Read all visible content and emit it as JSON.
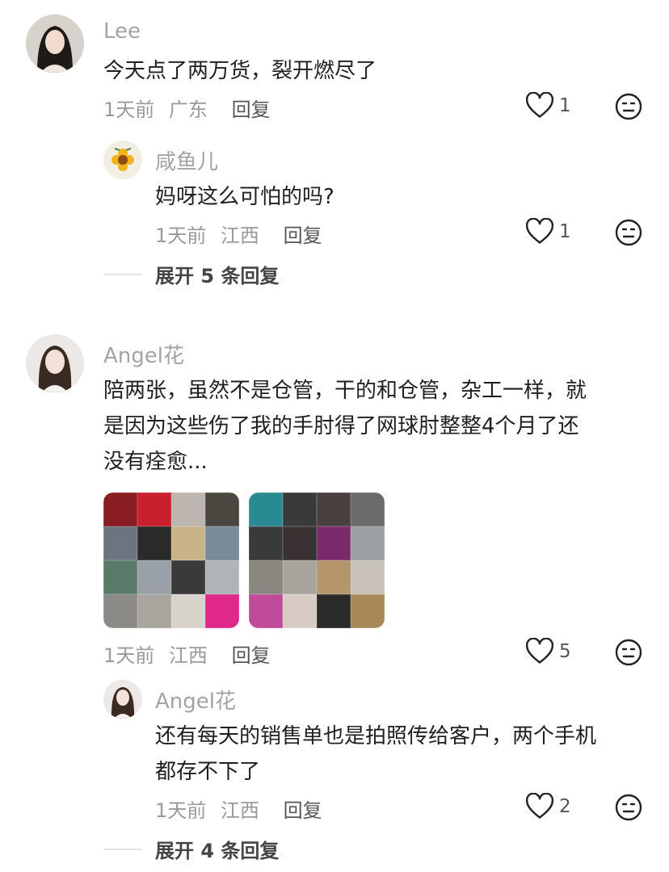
{
  "comments": [
    {
      "username": "Lee",
      "text": "今天点了两万货，裂开燃尽了",
      "time": "1天前",
      "location": "广东",
      "reply_label": "回复",
      "likes": "1",
      "replies": [
        {
          "username": "咸鱼儿",
          "text": "妈呀这么可怕的吗?",
          "time": "1天前",
          "location": "江西",
          "reply_label": "回复",
          "likes": "1"
        }
      ],
      "expand_label": "展开 5 条回复"
    },
    {
      "username": "Angel花",
      "text_lines": [
        "陪两张，虽然不是仓管，干的和仓管，杂工一样，就",
        "是因为这些伤了我的手肘得了网球肘整整4个月了还",
        "没有痊愈..."
      ],
      "time": "1天前",
      "location": "江西",
      "reply_label": "回复",
      "likes": "5",
      "replies": [
        {
          "username": "Angel花",
          "text_lines": [
            "还有每天的销售单也是拍照传给客户，两个手机",
            "都存不下了"
          ],
          "time": "1天前",
          "location": "江西",
          "reply_label": "回复",
          "likes": "2"
        }
      ],
      "expand_label": "展开 4 条回复"
    }
  ],
  "icons": {
    "like": "heart-outline-icon",
    "dislike": "neutral-face-icon"
  }
}
